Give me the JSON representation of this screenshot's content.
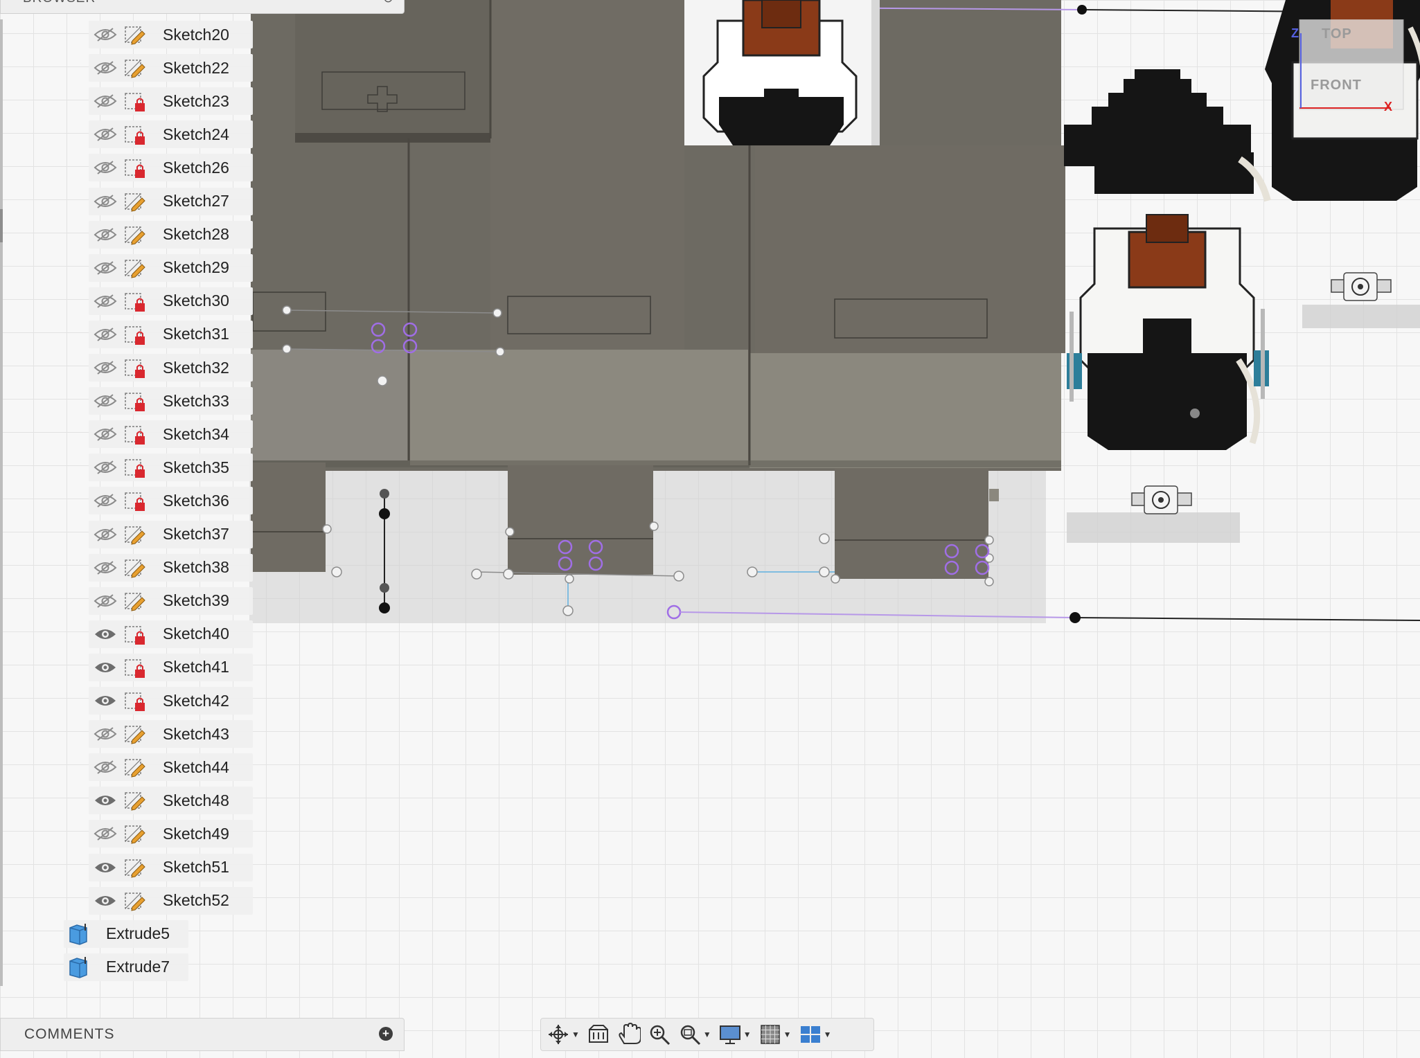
{
  "browser": {
    "title": "BROWSER"
  },
  "sketches": [
    {
      "label": "Sketch20",
      "visible": false,
      "icon": "sketch-edit-icon"
    },
    {
      "label": "Sketch22",
      "visible": false,
      "icon": "sketch-edit-icon"
    },
    {
      "label": "Sketch23",
      "visible": false,
      "icon": "sketch-locked-icon"
    },
    {
      "label": "Sketch24",
      "visible": false,
      "icon": "sketch-locked-icon"
    },
    {
      "label": "Sketch26",
      "visible": false,
      "icon": "sketch-locked-icon"
    },
    {
      "label": "Sketch27",
      "visible": false,
      "icon": "sketch-edit-icon"
    },
    {
      "label": "Sketch28",
      "visible": false,
      "icon": "sketch-edit-icon"
    },
    {
      "label": "Sketch29",
      "visible": false,
      "icon": "sketch-edit-icon"
    },
    {
      "label": "Sketch30",
      "visible": false,
      "icon": "sketch-locked-icon"
    },
    {
      "label": "Sketch31",
      "visible": false,
      "icon": "sketch-locked-icon"
    },
    {
      "label": "Sketch32",
      "visible": false,
      "icon": "sketch-locked-icon"
    },
    {
      "label": "Sketch33",
      "visible": false,
      "icon": "sketch-locked-icon"
    },
    {
      "label": "Sketch34",
      "visible": false,
      "icon": "sketch-locked-icon"
    },
    {
      "label": "Sketch35",
      "visible": false,
      "icon": "sketch-locked-icon"
    },
    {
      "label": "Sketch36",
      "visible": false,
      "icon": "sketch-locked-icon"
    },
    {
      "label": "Sketch37",
      "visible": false,
      "icon": "sketch-edit-icon"
    },
    {
      "label": "Sketch38",
      "visible": false,
      "icon": "sketch-edit-icon"
    },
    {
      "label": "Sketch39",
      "visible": false,
      "icon": "sketch-edit-icon"
    },
    {
      "label": "Sketch40",
      "visible": true,
      "icon": "sketch-locked-icon"
    },
    {
      "label": "Sketch41",
      "visible": true,
      "icon": "sketch-locked-icon"
    },
    {
      "label": "Sketch42",
      "visible": true,
      "icon": "sketch-locked-icon"
    },
    {
      "label": "Sketch43",
      "visible": false,
      "icon": "sketch-edit-icon"
    },
    {
      "label": "Sketch44",
      "visible": false,
      "icon": "sketch-edit-icon"
    },
    {
      "label": "Sketch48",
      "visible": true,
      "icon": "sketch-edit-icon"
    },
    {
      "label": "Sketch49",
      "visible": false,
      "icon": "sketch-edit-icon"
    },
    {
      "label": "Sketch51",
      "visible": true,
      "icon": "sketch-edit-icon"
    },
    {
      "label": "Sketch52",
      "visible": true,
      "icon": "sketch-edit-icon"
    }
  ],
  "extrudes": [
    {
      "label": "Extrude5",
      "icon": "extrude-body-icon"
    },
    {
      "label": "Extrude7",
      "icon": "extrude-body-icon"
    }
  ],
  "viewcube": {
    "top": "TOP",
    "front": "FRONT",
    "axis_z": "Z",
    "axis_x": "X"
  },
  "comments": {
    "title": "COMMENTS",
    "add_icon": "plus-icon"
  },
  "toolbar": {
    "tools": [
      "orbit-icon",
      "look-at-icon",
      "pan-icon",
      "zoom-icon",
      "fit-icon",
      "display-settings-icon",
      "grid-settings-icon",
      "viewports-icon"
    ]
  },
  "colors": {
    "panel_bg": "#f0f0f0",
    "model_gray": "#6e6a62",
    "model_light": "#8b877d",
    "sketch_purple": "#a06ee6",
    "switch_brown": "#8a3a18",
    "lock_red": "#d9282f",
    "pencil_orange": "#e8a030",
    "extrude_blue": "#3a8fd8"
  }
}
